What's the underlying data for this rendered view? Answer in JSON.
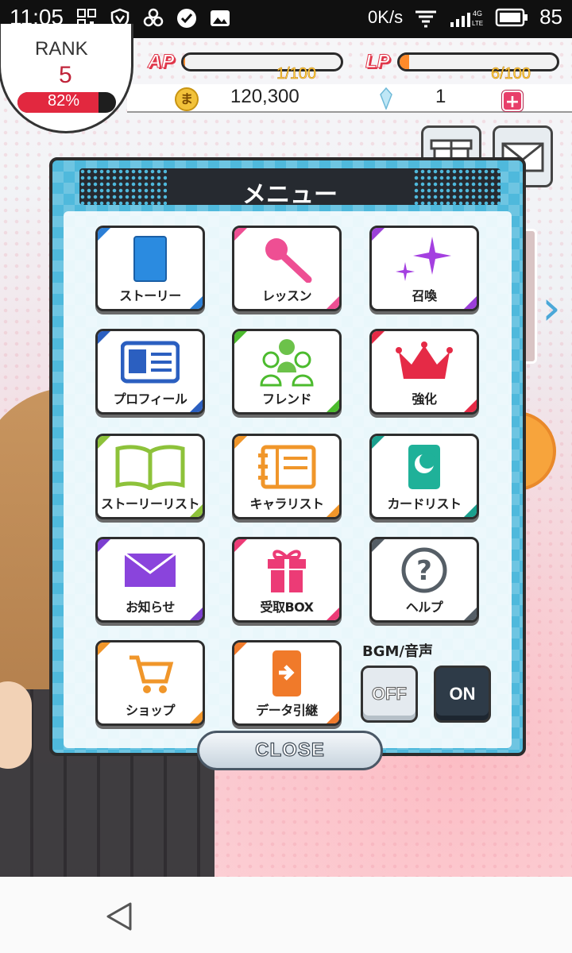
{
  "status_bar": {
    "time": "11:05",
    "net_speed": "0K/s",
    "net_type": "4G LTE",
    "battery": "85"
  },
  "hud": {
    "rank_label": "RANK",
    "rank_value": "5",
    "rank_progress": "82%",
    "rank_progress_fraction": 0.82,
    "ap_label": "AP",
    "ap_value": "1/100",
    "ap_fraction": 0.01,
    "lp_label": "LP",
    "lp_value": "6/100",
    "lp_fraction": 0.06,
    "coin_glyph": "ま",
    "money": "120,300",
    "crystals": "1",
    "plus": "+"
  },
  "menu": {
    "title": "メニュー",
    "items": [
      {
        "label": "ストーリー",
        "icon": "book-icon",
        "color": "#2b7fd6"
      },
      {
        "label": "レッスン",
        "icon": "microphone-icon",
        "color": "#ee4f93"
      },
      {
        "label": "召喚",
        "icon": "sparkle-icon",
        "color": "#9b3fd8"
      },
      {
        "label": "プロフィール",
        "icon": "profile-card-icon",
        "color": "#2b5fc0"
      },
      {
        "label": "フレンド",
        "icon": "friends-icon",
        "color": "#4cbb2e"
      },
      {
        "label": "強化",
        "icon": "crown-icon",
        "color": "#e52a46"
      },
      {
        "label": "ストーリーリスト",
        "icon": "open-book-icon",
        "color": "#8dc23a"
      },
      {
        "label": "キャラリスト",
        "icon": "notebook-icon",
        "color": "#f0962a"
      },
      {
        "label": "カードリスト",
        "icon": "card-icon",
        "color": "#1aa08e"
      },
      {
        "label": "お知らせ",
        "icon": "envelope-icon",
        "color": "#7b3ed0"
      },
      {
        "label": "受取BOX",
        "icon": "gift-icon",
        "color": "#ec3b76"
      },
      {
        "label": "ヘルプ",
        "icon": "help-icon",
        "color": "#555e66"
      },
      {
        "label": "ショップ",
        "icon": "cart-icon",
        "color": "#f0962a"
      },
      {
        "label": "データ引継",
        "icon": "phone-transfer-icon",
        "color": "#f07a2a"
      }
    ],
    "bgm_label": "BGM/音声",
    "bgm_off": "OFF",
    "bgm_on": "ON",
    "close_label": "CLOSE"
  }
}
